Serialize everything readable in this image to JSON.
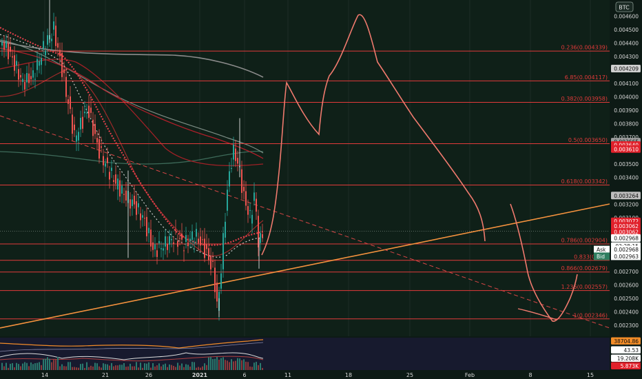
{
  "chart_data": {
    "type": "candlestick",
    "quote_currency": "BTC",
    "y_ticks": [
      "0.004600",
      "0.004500",
      "0.004400",
      "0.004300",
      "0.004100",
      "0.004000",
      "0.003900",
      "0.003800",
      "0.003700",
      "0.003500",
      "0.003400",
      "0.003200",
      "0.003100",
      "0.002700",
      "0.002600",
      "0.002500",
      "0.002400",
      "0.002300"
    ],
    "ylim": [
      0.00228,
      0.00474
    ],
    "x_ticks": [
      {
        "label": "14",
        "x": 65
      },
      {
        "label": "21",
        "x": 153
      },
      {
        "label": "26",
        "x": 216
      },
      {
        "label": "2021",
        "x": 290
      },
      {
        "label": "6",
        "x": 355
      },
      {
        "label": "11",
        "x": 418
      },
      {
        "label": "18",
        "x": 506
      },
      {
        "label": "25",
        "x": 595
      },
      {
        "label": "Feb",
        "x": 682
      },
      {
        "label": "8",
        "x": 770
      },
      {
        "label": "15",
        "x": 857
      }
    ],
    "fib_levels": [
      {
        "label": "0.236(0.004339)",
        "value": 0.004339
      },
      {
        "label": "6.85(0.004117)",
        "value": 0.004117
      },
      {
        "label": "0.382(0.003958)",
        "value": 0.003958
      },
      {
        "label": "0.5(0.003650)",
        "value": 0.00365
      },
      {
        "label": "0.618(0.003342)",
        "value": 0.003342
      },
      {
        "label": "0.786(0.002904)",
        "value": 0.002904
      },
      {
        "label": "0.833(0.002",
        "value": 0.002782
      },
      {
        "label": "0.866(0.002679)",
        "value": 0.002695
      },
      {
        "label": "1.236(0.002557)",
        "value": 0.002557
      },
      {
        "label": "1(0.002346)",
        "value": 0.002346
      }
    ],
    "price_tags": [
      {
        "text": "0.004209",
        "value": 0.004209,
        "bg": "#cfcfcf",
        "fg": "#111111"
      },
      {
        "text": "0.003665",
        "value": 0.003665,
        "bg": "#9e9e9e",
        "fg": "#111111"
      },
      {
        "text": "0.003640",
        "value": 0.00364,
        "bg": "#e0202a",
        "fg": "#ffffff"
      },
      {
        "text": "0.003610",
        "value": 0.00361,
        "bg": "#e0202a",
        "fg": "#ffffff"
      },
      {
        "text": "0.003264",
        "value": 0.003264,
        "bg": "#bdbdbd",
        "fg": "#111111"
      },
      {
        "text": "0.003072",
        "value": 0.003072,
        "bg": "#e0202a",
        "fg": "#ffffff"
      },
      {
        "text": "0.003062",
        "value": 0.003038,
        "bg": "#e0202a",
        "fg": "#ffffff"
      },
      {
        "text": "0.003062",
        "value": 0.002993,
        "bg": "#e0202a",
        "fg": "#ffffff"
      },
      {
        "text": "0.002968",
        "value": 0.002948,
        "bg": "#ffffff",
        "fg": "#111111"
      },
      {
        "text": "02:28:15",
        "value": 0.002888,
        "bg": "#ffffff",
        "fg": "#111111"
      }
    ],
    "quote": {
      "ask_label": "Ask",
      "ask": "0.002968",
      "bid_label": "Bid",
      "bid": "0.002963"
    },
    "indicator_tags": [
      {
        "text": "38704.86",
        "bg": "#f28c28",
        "fg": "#111111"
      },
      {
        "text": "43.53",
        "bg": "#ffffff",
        "fg": "#111111"
      },
      {
        "text": "19.208K",
        "bg": "#ffffff",
        "fg": "#111111"
      },
      {
        "text": "5.873K",
        "bg": "#e0202a",
        "fg": "#ffffff"
      }
    ],
    "colors": {
      "background": "#0d1a15",
      "up": "#26a69a",
      "down": "#ef5350",
      "fib": "#e33a3a",
      "trend": "#f5923e",
      "projection": "#f07a6e",
      "grid": "#1e2b26"
    }
  }
}
